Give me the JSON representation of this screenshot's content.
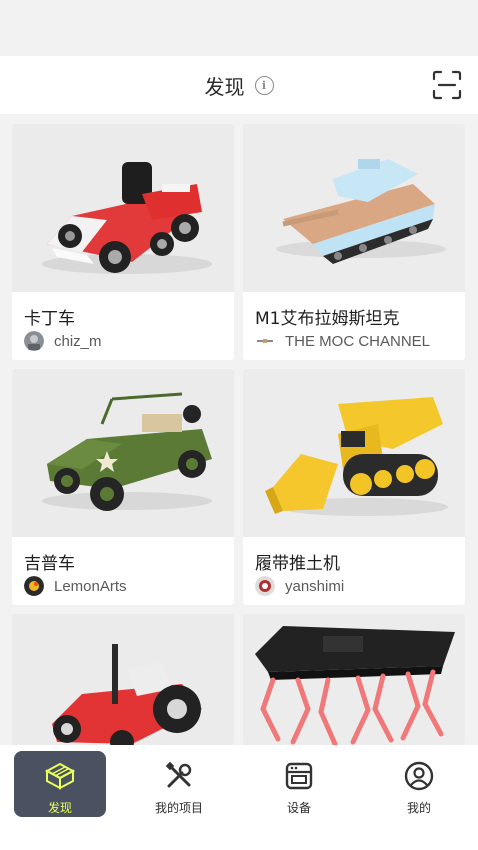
{
  "header": {
    "title": "发现",
    "info_icon": "info-icon",
    "scan_icon": "scan-icon"
  },
  "cards": [
    {
      "title": "卡丁车",
      "author": "chiz_m",
      "image": "go-kart-model"
    },
    {
      "title": "M1艾布拉姆斯坦克",
      "author": "THE MOC CHANNEL",
      "image": "tank-model"
    },
    {
      "title": "吉普车",
      "author": "LemonArts",
      "image": "jeep-model"
    },
    {
      "title": "履带推土机",
      "author": "yanshimi",
      "image": "bulldozer-model"
    },
    {
      "title": "",
      "author": "",
      "image": "tractor-model"
    },
    {
      "title": "",
      "author": "",
      "image": "walking-robot-model"
    }
  ],
  "nav": [
    {
      "label": "发现",
      "icon": "discover-icon",
      "active": true
    },
    {
      "label": "我的项目",
      "icon": "tools-icon",
      "active": false
    },
    {
      "label": "设备",
      "icon": "printer-icon",
      "active": false
    },
    {
      "label": "我的",
      "icon": "profile-icon",
      "active": false
    }
  ],
  "colors": {
    "accent": "#e9ff5a",
    "active_nav_bg": "#4a5160",
    "background": "#f2f2f2"
  }
}
